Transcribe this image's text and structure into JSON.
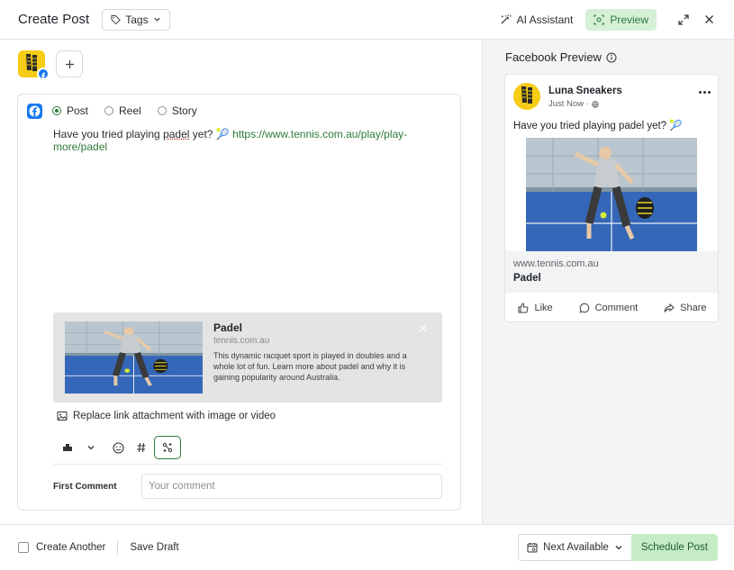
{
  "header": {
    "title": "Create Post",
    "tags_label": "Tags",
    "ai_label": "AI Assistant",
    "preview_label": "Preview"
  },
  "editor": {
    "post_types": [
      "Post",
      "Reel",
      "Story"
    ],
    "selected_type": "Post",
    "text_before": "Have you tried playing ",
    "text_word": "padel",
    "text_after": " yet? 🎾 ",
    "link": "https://www.tennis.com.au/play/play-more/padel",
    "link_card": {
      "title": "Padel",
      "domain": "tennis.com.au",
      "description": "This dynamic racquet sport is played in doubles and a whole lot of fun. Learn more about padel and why it is gaining popularity around Australia."
    },
    "replace_label": "Replace link attachment with image or video",
    "first_comment_label": "First Comment",
    "first_comment_placeholder": "Your comment"
  },
  "preview": {
    "heading": "Facebook Preview",
    "page_name": "Luna Sneakers",
    "meta": "Just Now ·",
    "text": "Have you tried playing padel yet? 🎾",
    "link_domain": "www.tennis.com.au",
    "link_title": "Padel",
    "actions": [
      "Like",
      "Comment",
      "Share"
    ]
  },
  "footer": {
    "create_another_label": "Create Another",
    "save_draft_label": "Save Draft",
    "next_available_label": "Next Available",
    "schedule_label": "Schedule Post"
  },
  "colors": {
    "accent_green": "#2d7a3a",
    "preview_bg": "#d6f0d8",
    "facebook_blue": "#1877f2",
    "brand_yellow": "#f6cc15"
  }
}
